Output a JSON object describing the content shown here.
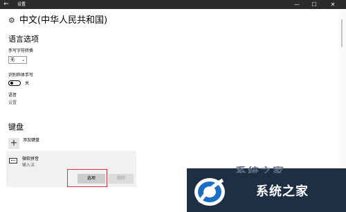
{
  "window": {
    "title": "设置",
    "back_icon": "←",
    "minimize_icon": "—",
    "maximize_icon": "☐",
    "close_icon": "✕"
  },
  "page": {
    "title": "中文(中华人民共和国)",
    "gear_icon": "⚙"
  },
  "language_options": {
    "section_title": "语言选项",
    "handwriting_char_label": "手写字符转换",
    "handwriting_char_value": "无",
    "chevron": "⌄",
    "italic_handwriting_label": "识别斜体手写",
    "toggle_state": "关",
    "speech_label": "语音",
    "speech_settings_link": "设置"
  },
  "keyboard": {
    "section_title": "键盘",
    "add_icon": "+",
    "add_label": "添加键盘",
    "ime_name": "微软拼音",
    "ime_type": "输入法",
    "options_button": "选项",
    "remove_button": "删除"
  },
  "watermark": {
    "text": "系统之家",
    "top_text": "系统之家"
  },
  "colors": {
    "titlebar": "#2b2b2b",
    "highlight": "#d9333f",
    "watermark_bg": "#1e2f44",
    "watermark_blue": "#1a6fc4"
  }
}
